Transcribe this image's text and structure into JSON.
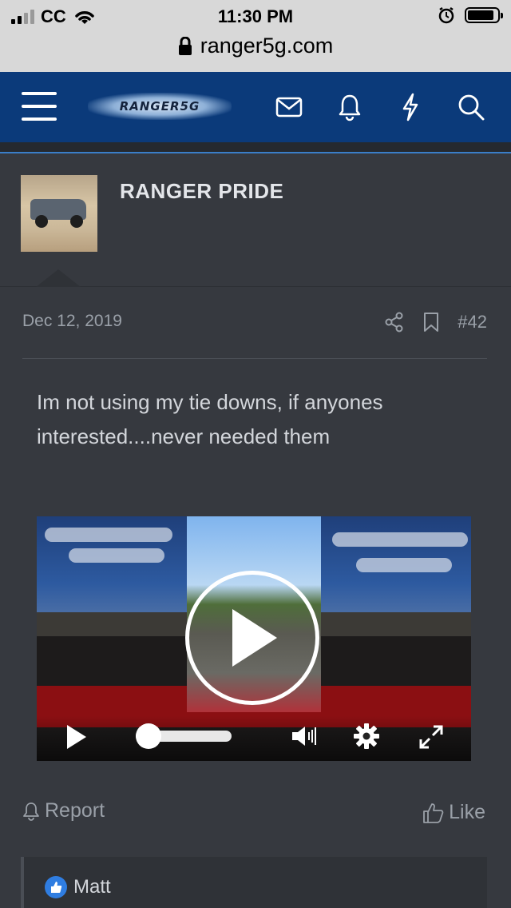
{
  "status_bar": {
    "carrier": "CC",
    "time": "11:30 PM",
    "url": "ranger5g.com"
  },
  "header": {
    "logo_text": "RANGER5G",
    "icons": [
      "menu-icon",
      "envelope-icon",
      "bell-icon",
      "lightning-icon",
      "search-icon"
    ]
  },
  "post": {
    "author": "RANGER PRIDE",
    "date": "Dec 12, 2019",
    "post_number": "#42",
    "message": "Im not using my tie downs, if anyones interested....never needed them"
  },
  "video": {
    "volume_level": 0.0
  },
  "actions": {
    "report_label": "Report",
    "like_label": "Like"
  },
  "reactions": {
    "user": "Matt"
  },
  "colors": {
    "header_bg": "#0b3a7a",
    "body_bg": "#36393f",
    "accent": "#3a7ec8",
    "like_blue": "#2f7de1"
  }
}
